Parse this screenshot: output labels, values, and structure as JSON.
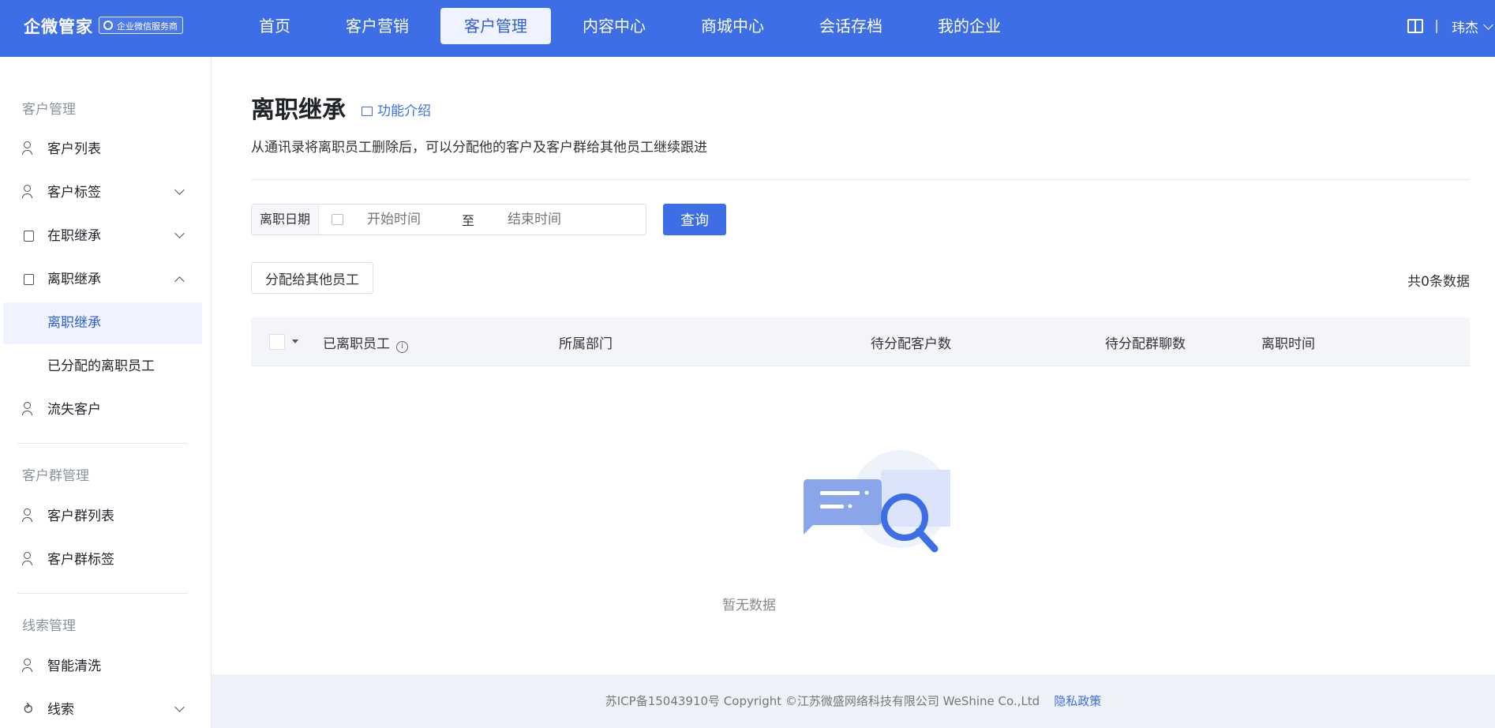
{
  "brand": {
    "name": "企微管家",
    "badge": "企业微信服务商"
  },
  "nav": [
    {
      "label": "首页"
    },
    {
      "label": "客户营销"
    },
    {
      "label": "客户管理"
    },
    {
      "label": "内容中心"
    },
    {
      "label": "商城中心"
    },
    {
      "label": "会话存档"
    },
    {
      "label": "我的企业"
    }
  ],
  "user": {
    "name": "玮杰"
  },
  "sidebar": {
    "section1": "客户管理",
    "items1": [
      {
        "label": "客户列表"
      },
      {
        "label": "客户标签"
      },
      {
        "label": "在职继承"
      },
      {
        "label": "离职继承"
      },
      {
        "label": "离职继承"
      },
      {
        "label": "已分配的离职员工"
      },
      {
        "label": "流失客户"
      }
    ],
    "section2": "客户群管理",
    "items2": [
      {
        "label": "客户群列表"
      },
      {
        "label": "客户群标签"
      }
    ],
    "section3": "线索管理",
    "items3": [
      {
        "label": "智能清洗"
      },
      {
        "label": "线索"
      }
    ]
  },
  "page": {
    "title": "离职继承",
    "intro_link": "功能介绍",
    "description": "从通讯录将离职员工删除后，可以分配他的客户及客户群给其他员工继续跟进"
  },
  "filter": {
    "label": "离职日期",
    "start_placeholder": "开始时间",
    "to": "至",
    "end_placeholder": "结束时间",
    "query_button": "查询"
  },
  "actions": {
    "assign_button": "分配给其他员工",
    "total": "共0条数据"
  },
  "table": {
    "columns": [
      "已离职员工",
      "所属部门",
      "待分配客户数",
      "待分配群聊数",
      "离职时间"
    ]
  },
  "empty": {
    "text": "暂无数据"
  },
  "footer": {
    "text": "苏ICP备15043910号 Copyright ©江苏微盛网络科技有限公司 WeShine Co.,Ltd",
    "privacy": "隐私政策"
  }
}
